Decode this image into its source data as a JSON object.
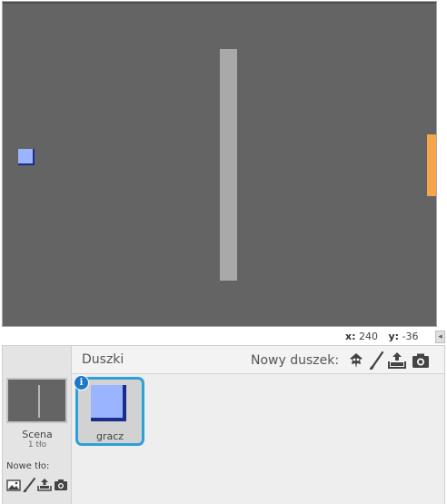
{
  "stage": {
    "coords": {
      "x_label": "x:",
      "x_value": "240",
      "y_label": "y:",
      "y_value": "-36"
    },
    "scroll_arrow": "◂",
    "colors": {
      "background": "#646464",
      "wall": "#a9a9a9",
      "player": "#9bb4ff",
      "player_shadow": "#1a2c8c",
      "goal": "#f6a54a"
    }
  },
  "sprites_panel": {
    "title": "Duszki",
    "new_sprite_label": "Nowy duszek:",
    "new_sprite_icons": [
      "sprite-library-icon",
      "paint-brush-icon",
      "upload-icon",
      "camera-icon"
    ],
    "selected_color": "#2ea0d8",
    "sprites": [
      {
        "name": "gracz",
        "info": "i"
      }
    ]
  },
  "stage_column": {
    "label": "Scena",
    "backdrops": "1 tło",
    "new_backdrop_label": "Nowe tło:",
    "new_backdrop_icons": [
      "backdrop-library-icon",
      "paint-brush-icon",
      "upload-icon",
      "camera-icon"
    ]
  }
}
